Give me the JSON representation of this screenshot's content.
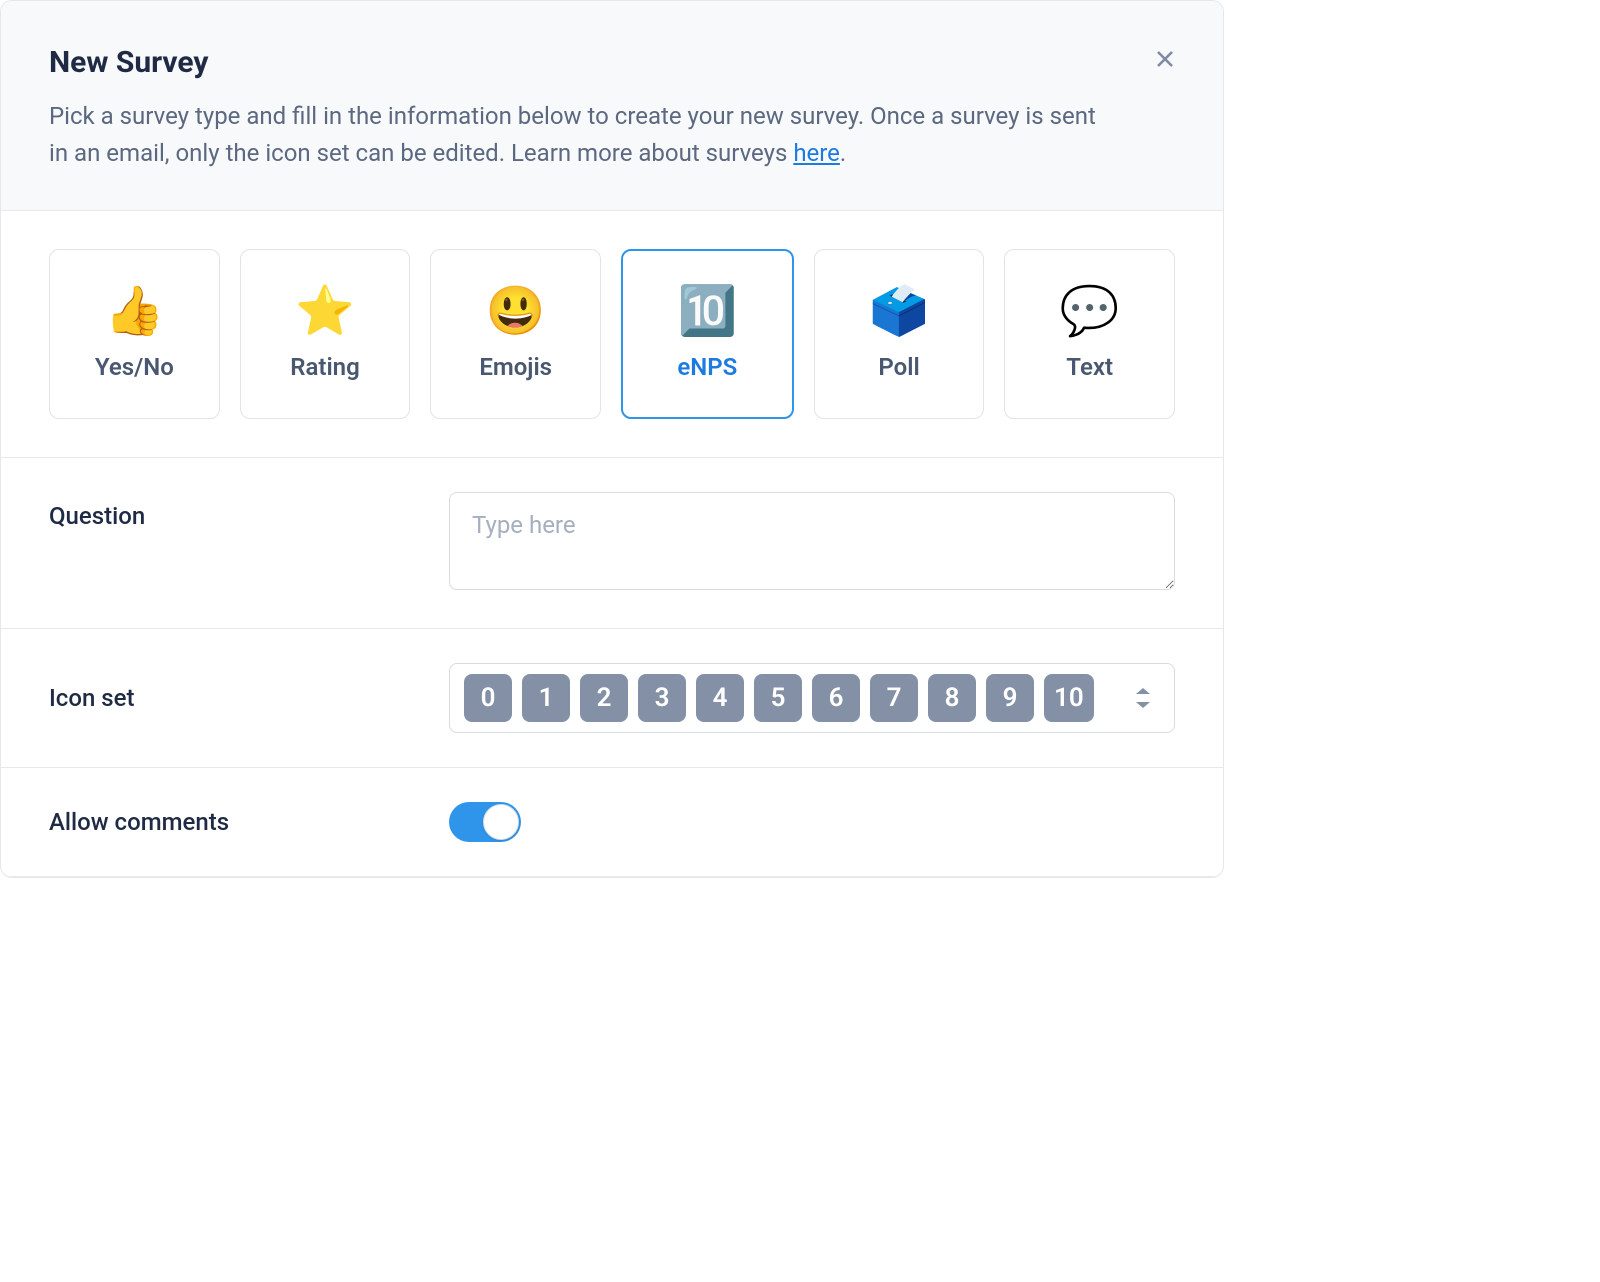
{
  "header": {
    "title": "New Survey",
    "description_before": "Pick a survey type and fill in the information below to create your new survey. Once a survey is sent in an email, only the icon set can be edited. Learn more about surveys ",
    "link_text": "here",
    "description_after": "."
  },
  "types": [
    {
      "icon": "👍",
      "label": "Yes/No",
      "selected": false
    },
    {
      "icon": "⭐",
      "label": "Rating",
      "selected": false
    },
    {
      "icon": "😃",
      "label": "Emojis",
      "selected": false
    },
    {
      "icon": "🔟",
      "label": "eNPS",
      "selected": true
    },
    {
      "icon": "🗳️",
      "label": "Poll",
      "selected": false
    },
    {
      "icon": "💬",
      "label": "Text",
      "selected": false
    }
  ],
  "form": {
    "question_label": "Question",
    "question_placeholder": "Type here",
    "iconset_label": "Icon set",
    "iconset_values": [
      "0",
      "1",
      "2",
      "3",
      "4",
      "5",
      "6",
      "7",
      "8",
      "9",
      "10"
    ],
    "allow_comments_label": "Allow comments",
    "allow_comments_on": true
  }
}
